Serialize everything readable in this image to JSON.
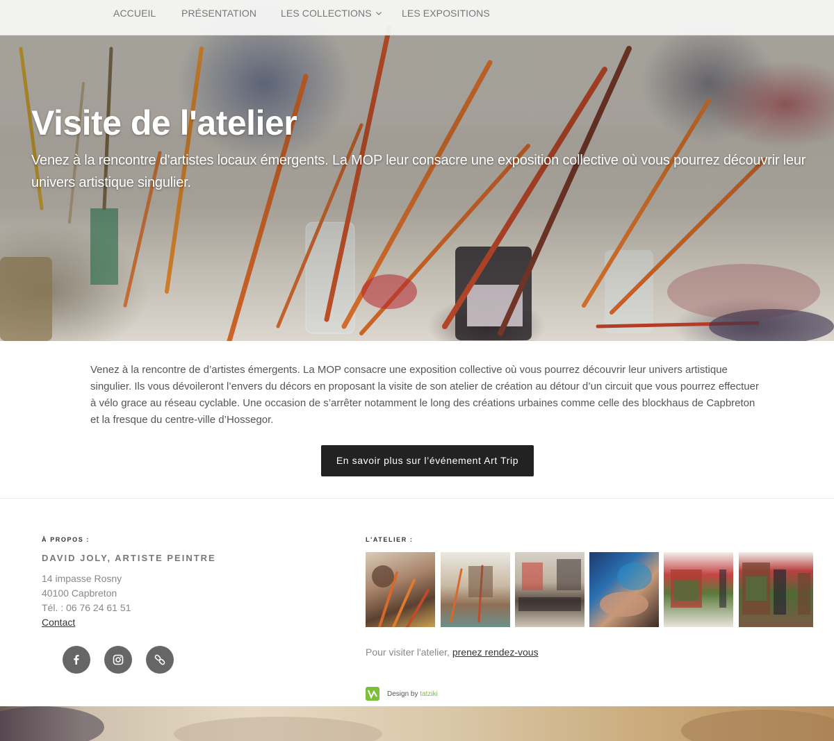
{
  "nav": {
    "items": [
      {
        "label": "ACCUEIL"
      },
      {
        "label": "PRÉSENTATION"
      },
      {
        "label": "LES COLLECTIONS"
      },
      {
        "label": "LES EXPOSITIONS"
      }
    ]
  },
  "hero": {
    "title": "Visite de l'atelier",
    "subtitle": "Venez à la rencontre d'artistes locaux émergents. La MOP leur consacre une exposition collective où vous pourrez découvrir leur univers artistique singulier."
  },
  "intro": {
    "text": "Venez à la rencontre de d’artistes émergents. La MOP consacre une exposition collective où vous pourrez découvrir leur univers artistique singulier. Ils vous dévoileront l’envers du décors en proposant la visite de son atelier de création au détour d’un circuit que vous pourrez effectuer à vélo grace au réseau cyclable. Une occasion de s’arrêter notamment le long des créations urbaines comme celle des blockhaus de Capbreton et la fresque du centre-ville d’Hossegor."
  },
  "cta": {
    "label": "En savoir plus sur l’événement Art Trip"
  },
  "footer": {
    "about": {
      "label": "À PROPOS :",
      "name": "DAVID JOLY, ARTISTE PEINTRE",
      "address1": "14 impasse Rosny",
      "address2": "40100 Capbreton",
      "phone": "Tél. : 06 76 24 61 51",
      "contact": "Contact"
    },
    "social": [
      {
        "icon": "facebook-icon"
      },
      {
        "icon": "instagram-icon"
      },
      {
        "icon": "link-icon"
      }
    ],
    "atelier": {
      "label": "L'ATELIER :",
      "visit_prefix": "Pour visiter l'atelier, ",
      "visit_link": "prenez rendez-vous"
    },
    "design": {
      "prefix": "Design by ",
      "link": "tatziki"
    }
  },
  "colors": {
    "accent_green": "#7cbf3a",
    "button_bg": "#222222",
    "social_bg": "#666666"
  }
}
